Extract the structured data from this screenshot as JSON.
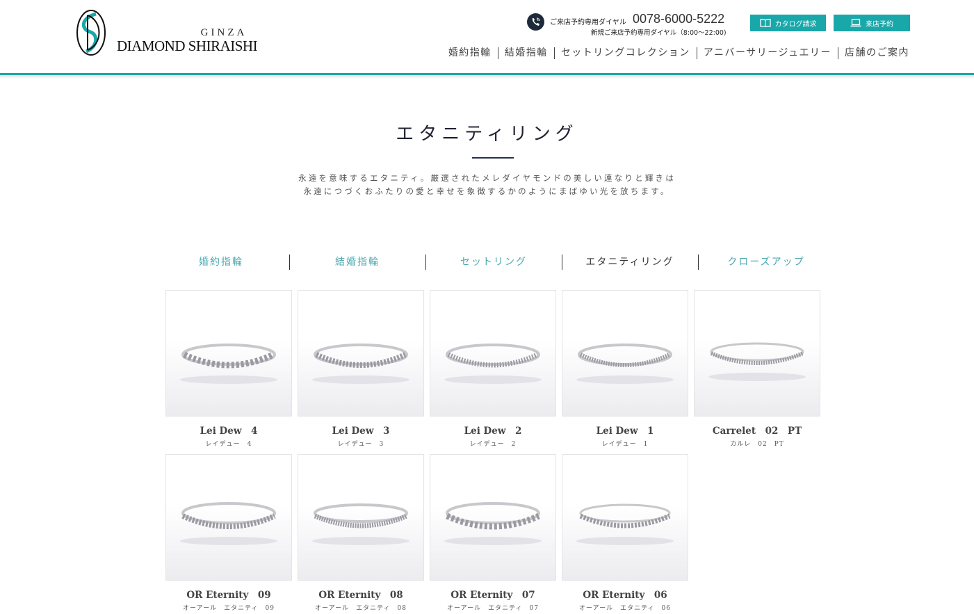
{
  "brand": {
    "ginza": "GINZA",
    "name": "DIAMOND SHIRAISHI",
    "accent_color": "#1aa7a9"
  },
  "contact": {
    "phone_label": "ご来店予約専用ダイヤル",
    "phone_number": "0078-6000-5222",
    "phone_sub": "新規ご来店予約専用ダイヤル（8:00～22:00)",
    "phone_icon": "phone-icon"
  },
  "buttons": {
    "catalog": "カタログ請求",
    "reserve": "来店予約"
  },
  "global_nav": [
    "婚約指輪",
    "結婚指輪",
    "セットリングコレクション",
    "アニバーサリージュエリー",
    "店舗のご案内"
  ],
  "page": {
    "title": "エタニティリング",
    "lead_line1": "永遠を意味するエタニティ。厳選されたメレダイヤモンドの美しい連なりと輝きは",
    "lead_line2": "永遠につづくおふたりの愛と幸せを象徴するかのようにまばゆい光を放ちます。"
  },
  "sub_nav": [
    {
      "label": "婚約指輪",
      "active": false
    },
    {
      "label": "結婚指輪",
      "active": false
    },
    {
      "label": "セットリング",
      "active": false
    },
    {
      "label": "エタニティリング",
      "active": true
    },
    {
      "label": "クローズアップ",
      "active": false
    }
  ],
  "products": [
    {
      "name": "Lei Dew　4",
      "kana": "レイデュー　4"
    },
    {
      "name": "Lei Dew　3",
      "kana": "レイデュー　3"
    },
    {
      "name": "Lei Dew　2",
      "kana": "レイデュー　2"
    },
    {
      "name": "Lei Dew　1",
      "kana": "レイデュー　1"
    },
    {
      "name": "Carrelet　02　PT",
      "kana": "カルレ　02　PT"
    },
    {
      "name": "OR Eternity　09",
      "kana": "オーアール　エタニティ　09"
    },
    {
      "name": "OR Eternity　08",
      "kana": "オーアール　エタニティ　08"
    },
    {
      "name": "OR Eternity　07",
      "kana": "オーアール　エタニティ　07"
    },
    {
      "name": "OR Eternity　06",
      "kana": "オーアール　エタニティ　06"
    }
  ]
}
